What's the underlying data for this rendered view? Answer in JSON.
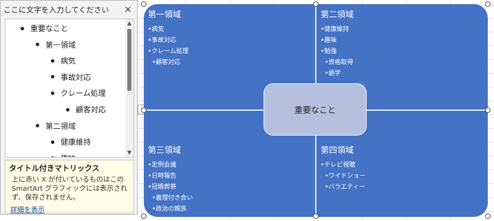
{
  "text_pane": {
    "title": "ここに文字を入力してください",
    "close_glyph": "×",
    "outline": [
      {
        "label": "重要なこと",
        "level": 1
      },
      {
        "label": "第一領域",
        "level": 2
      },
      {
        "label": "病気",
        "level": 3
      },
      {
        "label": "事故対応",
        "level": 3
      },
      {
        "label": "クレーム処理",
        "level": 3
      },
      {
        "label": "顧客対応",
        "level": 4
      },
      {
        "label": "第二領域",
        "level": 2
      },
      {
        "label": "健康維持",
        "level": 3
      },
      {
        "label": "趣味",
        "level": 3
      }
    ],
    "info": {
      "title": "タイトル付きマトリックス",
      "text": "上に赤い X が付いているものはこのSmartArt グラフィックには表示されず、保存されません。",
      "link": "詳細を表示"
    }
  },
  "smartart": {
    "center": "重要なこと",
    "quadrants": [
      {
        "title": "第一領域",
        "items": [
          {
            "text": "•病気",
            "level": 1
          },
          {
            "text": "•事故対応",
            "level": 1
          },
          {
            "text": "•クレーム処理",
            "level": 1
          },
          {
            "text": "•顧客対応",
            "level": 2
          }
        ]
      },
      {
        "title": "第二領域",
        "items": [
          {
            "text": "•健康維持",
            "level": 1
          },
          {
            "text": "•趣味",
            "level": 1
          },
          {
            "text": "•勉強",
            "level": 1
          },
          {
            "text": "•資格取得",
            "level": 2
          },
          {
            "text": "•語学",
            "level": 2
          }
        ]
      },
      {
        "title": "第三領域",
        "items": [
          {
            "text": "•定例会議",
            "level": 1
          },
          {
            "text": "•日時報告",
            "level": 1
          },
          {
            "text": "•冠婚葬祭",
            "level": 1
          },
          {
            "text": "•義理付き合い",
            "level": 2
          },
          {
            "text": "•政治の親族",
            "level": 2
          }
        ]
      },
      {
        "title": "第四領域",
        "items": [
          {
            "text": "•テレビ視聴",
            "level": 1
          },
          {
            "text": "•ワイドショー",
            "level": 2
          },
          {
            "text": "•バラエティー",
            "level": 2
          }
        ]
      }
    ]
  },
  "colors": {
    "quadrant_fill": "#4472c4",
    "center_fill": "#b4c0de",
    "info_background": "#fffde6"
  }
}
